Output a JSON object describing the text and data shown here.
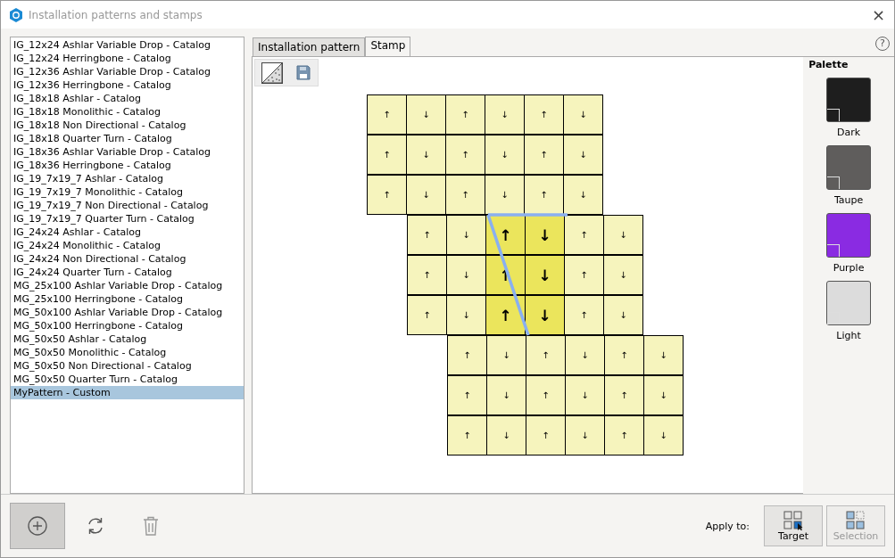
{
  "window": {
    "title": "Installation patterns and stamps",
    "close": "×"
  },
  "patterns": [
    {
      "label": "IG_12x24 Ashlar Variable Drop - Catalog",
      "selected": false
    },
    {
      "label": "IG_12x24 Herringbone - Catalog",
      "selected": false
    },
    {
      "label": "IG_12x36 Ashlar Variable Drop - Catalog",
      "selected": false
    },
    {
      "label": "IG_12x36 Herringbone - Catalog",
      "selected": false
    },
    {
      "label": "IG_18x18 Ashlar - Catalog",
      "selected": false
    },
    {
      "label": "IG_18x18 Monolithic - Catalog",
      "selected": false
    },
    {
      "label": "IG_18x18 Non Directional - Catalog",
      "selected": false
    },
    {
      "label": "IG_18x18 Quarter Turn - Catalog",
      "selected": false
    },
    {
      "label": "IG_18x36 Ashlar Variable Drop - Catalog",
      "selected": false
    },
    {
      "label": "IG_18x36 Herringbone - Catalog",
      "selected": false
    },
    {
      "label": "IG_19_7x19_7 Ashlar - Catalog",
      "selected": false
    },
    {
      "label": "IG_19_7x19_7 Monolithic - Catalog",
      "selected": false
    },
    {
      "label": "IG_19_7x19_7 Non Directional - Catalog",
      "selected": false
    },
    {
      "label": "IG_19_7x19_7 Quarter Turn - Catalog",
      "selected": false
    },
    {
      "label": "IG_24x24 Ashlar - Catalog",
      "selected": false
    },
    {
      "label": "IG_24x24 Monolithic - Catalog",
      "selected": false
    },
    {
      "label": "IG_24x24 Non Directional - Catalog",
      "selected": false
    },
    {
      "label": "IG_24x24 Quarter Turn - Catalog",
      "selected": false
    },
    {
      "label": "MG_25x100 Ashlar Variable Drop - Catalog",
      "selected": false
    },
    {
      "label": "MG_25x100 Herringbone - Catalog",
      "selected": false
    },
    {
      "label": "MG_50x100 Ashlar Variable Drop - Catalog",
      "selected": false
    },
    {
      "label": "MG_50x100 Herringbone - Catalog",
      "selected": false
    },
    {
      "label": "MG_50x50 Ashlar - Catalog",
      "selected": false
    },
    {
      "label": "MG_50x50 Monolithic - Catalog",
      "selected": false
    },
    {
      "label": "MG_50x50 Non Directional - Catalog",
      "selected": false
    },
    {
      "label": "MG_50x50 Quarter Turn - Catalog",
      "selected": false
    },
    {
      "label": "MyPattern - Custom",
      "selected": true
    }
  ],
  "tabs": [
    {
      "label": "Installation pattern",
      "selected": false
    },
    {
      "label": "Stamp",
      "selected": true
    }
  ],
  "help": "?",
  "bands": [
    {
      "rows": [
        {
          "tiles": [
            {
              "arrow": "↑",
              "selected": false
            },
            {
              "arrow": "↓",
              "selected": false
            },
            {
              "arrow": "↑",
              "selected": false
            },
            {
              "arrow": "↓",
              "selected": false
            },
            {
              "arrow": "↑",
              "selected": false
            },
            {
              "arrow": "↓",
              "selected": false
            }
          ]
        },
        {
          "tiles": [
            {
              "arrow": "↑",
              "selected": false
            },
            {
              "arrow": "↓",
              "selected": false
            },
            {
              "arrow": "↑",
              "selected": false
            },
            {
              "arrow": "↓",
              "selected": false
            },
            {
              "arrow": "↑",
              "selected": false
            },
            {
              "arrow": "↓",
              "selected": false
            }
          ]
        },
        {
          "tiles": [
            {
              "arrow": "↑",
              "selected": false
            },
            {
              "arrow": "↓",
              "selected": false
            },
            {
              "arrow": "↑",
              "selected": false
            },
            {
              "arrow": "↓",
              "selected": false
            },
            {
              "arrow": "↑",
              "selected": false
            },
            {
              "arrow": "↓",
              "selected": false
            }
          ]
        }
      ]
    },
    {
      "rows": [
        {
          "tiles": [
            {
              "arrow": "↑",
              "selected": false
            },
            {
              "arrow": "↓",
              "selected": false
            },
            {
              "arrow": "↑",
              "selected": true
            },
            {
              "arrow": "↓",
              "selected": true
            },
            {
              "arrow": "↑",
              "selected": false
            },
            {
              "arrow": "↓",
              "selected": false
            }
          ]
        },
        {
          "tiles": [
            {
              "arrow": "↑",
              "selected": false
            },
            {
              "arrow": "↓",
              "selected": false
            },
            {
              "arrow": "↑",
              "selected": true
            },
            {
              "arrow": "↓",
              "selected": true
            },
            {
              "arrow": "↑",
              "selected": false
            },
            {
              "arrow": "↓",
              "selected": false
            }
          ]
        },
        {
          "tiles": [
            {
              "arrow": "↑",
              "selected": false
            },
            {
              "arrow": "↓",
              "selected": false
            },
            {
              "arrow": "↑",
              "selected": true
            },
            {
              "arrow": "↓",
              "selected": true
            },
            {
              "arrow": "↑",
              "selected": false
            },
            {
              "arrow": "↓",
              "selected": false
            }
          ]
        }
      ]
    },
    {
      "rows": [
        {
          "tiles": [
            {
              "arrow": "↑",
              "selected": false
            },
            {
              "arrow": "↓",
              "selected": false
            },
            {
              "arrow": "↑",
              "selected": false
            },
            {
              "arrow": "↓",
              "selected": false
            },
            {
              "arrow": "↑",
              "selected": false
            },
            {
              "arrow": "↓",
              "selected": false
            }
          ]
        },
        {
          "tiles": [
            {
              "arrow": "↑",
              "selected": false
            },
            {
              "arrow": "↓",
              "selected": false
            },
            {
              "arrow": "↑",
              "selected": false
            },
            {
              "arrow": "↓",
              "selected": false
            },
            {
              "arrow": "↑",
              "selected": false
            },
            {
              "arrow": "↓",
              "selected": false
            }
          ]
        },
        {
          "tiles": [
            {
              "arrow": "↑",
              "selected": false
            },
            {
              "arrow": "↓",
              "selected": false
            },
            {
              "arrow": "↑",
              "selected": false
            },
            {
              "arrow": "↓",
              "selected": false
            },
            {
              "arrow": "↑",
              "selected": false
            },
            {
              "arrow": "↓",
              "selected": false
            }
          ]
        }
      ]
    }
  ],
  "palette": {
    "title": "Palette",
    "items": [
      {
        "label": "Dark",
        "color": "#1e1e1e"
      },
      {
        "label": "Taupe",
        "color": "#5f5d5c"
      },
      {
        "label": "Purple",
        "color": "#8a2be2"
      },
      {
        "label": "Light",
        "color": "#dcdcdc"
      }
    ]
  },
  "footer": {
    "add_pressed": true,
    "apply_label": "Apply to:",
    "buttons": [
      {
        "label": "Target",
        "disabled": false
      },
      {
        "label": "Selection",
        "disabled": true
      }
    ]
  }
}
